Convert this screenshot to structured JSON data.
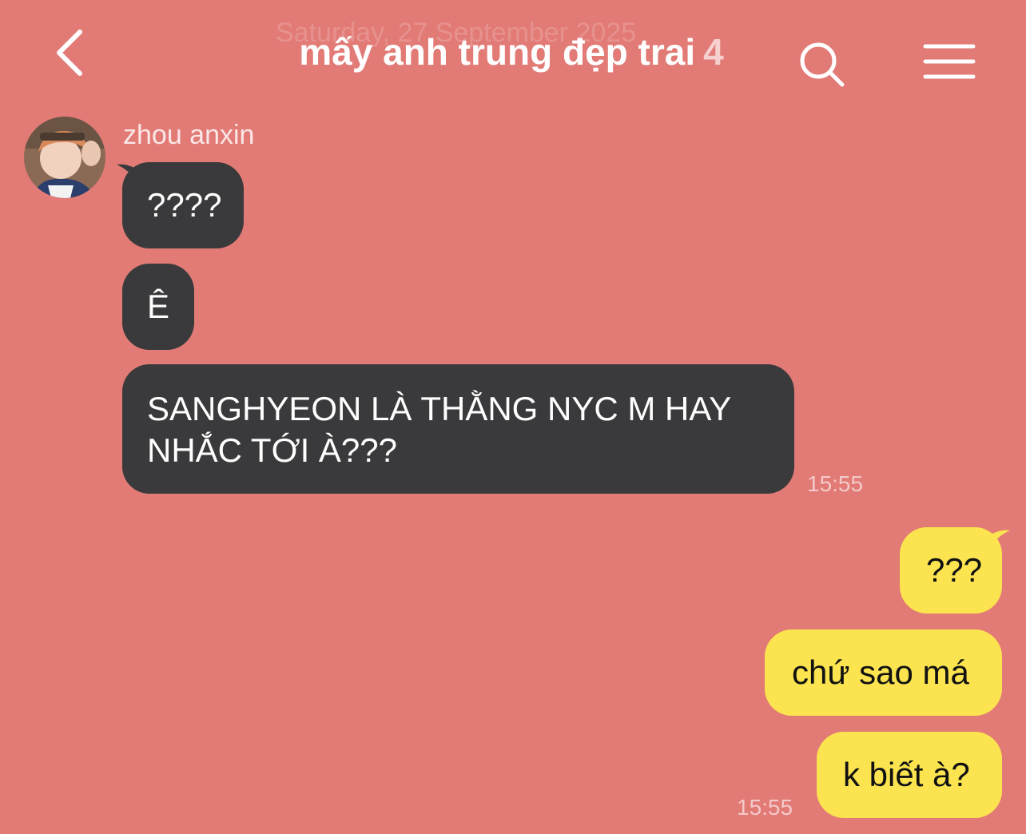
{
  "header": {
    "ghost_date": "Saturday, 27 September 2025",
    "title": "mấy anh trung đẹp trai",
    "member_count": "4"
  },
  "colors": {
    "background": "#E27A76",
    "incoming_bubble": "#3A3A3C",
    "outgoing_bubble": "#FBE44F"
  },
  "icons": {
    "back": "chevron-left-icon",
    "search": "search-icon",
    "menu": "hamburger-menu-icon"
  },
  "sender": {
    "name": "zhou anxin"
  },
  "messages_in": [
    {
      "text": "????"
    },
    {
      "text": "Ê"
    },
    {
      "line1": "SANGHYEON LÀ THẰNG NYC M HAY",
      "line2": "NHẮC TỚI À???",
      "time": "15:55"
    }
  ],
  "messages_out": [
    {
      "text": "???"
    },
    {
      "text": "chứ sao má"
    },
    {
      "text": "k biết à?",
      "time": "15:55"
    }
  ]
}
